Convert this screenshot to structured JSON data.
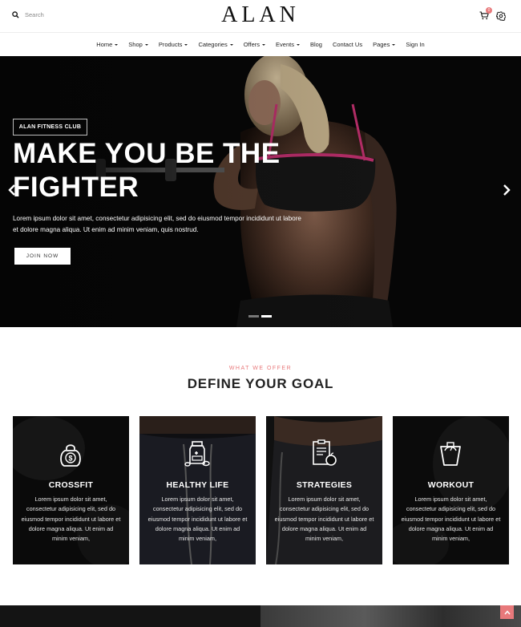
{
  "header": {
    "logo": "ALAN",
    "search_placeholder": "Search",
    "cart_count": "0",
    "icons": {
      "search": "search-icon",
      "cart": "cart-icon",
      "settings": "gear-icon"
    }
  },
  "nav": {
    "items": [
      {
        "label": "Home",
        "dropdown": true
      },
      {
        "label": "Shop",
        "dropdown": true
      },
      {
        "label": "Products",
        "dropdown": true
      },
      {
        "label": "Categories",
        "dropdown": true
      },
      {
        "label": "Offers",
        "dropdown": true
      },
      {
        "label": "Events",
        "dropdown": true
      },
      {
        "label": "Blog",
        "dropdown": false
      },
      {
        "label": "Contact Us",
        "dropdown": false
      },
      {
        "label": "Pages",
        "dropdown": true
      },
      {
        "label": "Sign In",
        "dropdown": false
      }
    ]
  },
  "hero": {
    "badge": "ALAN FITNESS CLUB",
    "title_line1": "MAKE YOU BE THE",
    "title_line2": "FIGHTER",
    "text_line1": "Lorem ipsum dolor sit amet, consectetur adipisicing elit, sed do eiusmod tempor incididunt ut labore",
    "text_line2": "et dolore magna aliqua. Ut enim ad minim veniam, quis nostrud.",
    "button": "JOIN NOW",
    "slide_count": 2,
    "active_slide": 2
  },
  "offer": {
    "kicker": "WHAT WE OFFER",
    "title": "DEFINE YOUR GOAL",
    "cards": [
      {
        "title": "CROSSFIT",
        "icon": "kettlebell-icon",
        "text": "Lorem ipsum dolor sit amet, consectetur adipisicing elit, sed do eiusmod tempor incididunt ut labore et dolore magna aliqua. Ut enim ad minim veniam,"
      },
      {
        "title": "HEALTHY LIFE",
        "icon": "supplement-bottle-icon",
        "text": "Lorem ipsum dolor sit amet, consectetur adipisicing elit, sed do eiusmod tempor incididunt ut labore et dolore magna aliqua. Ut enim ad minim veniam,"
      },
      {
        "title": "STRATEGIES",
        "icon": "diet-plan-icon",
        "text": "Lorem ipsum dolor sit amet, consectetur adipisicing elit, sed do eiusmod tempor incididunt ut labore et dolore magna aliqua. Ut enim ad minim veniam,"
      },
      {
        "title": "WORKOUT",
        "icon": "scale-icon",
        "text": "Lorem ipsum dolor sit amet, consectetur adipisicing elit, sed do eiusmod tempor incididunt ut labore et dolore magna aliqua. Ut enim ad minim veniam,"
      }
    ]
  },
  "colors": {
    "accent": "#e8797b",
    "dark": "#0d0d0d",
    "text": "#222222"
  }
}
